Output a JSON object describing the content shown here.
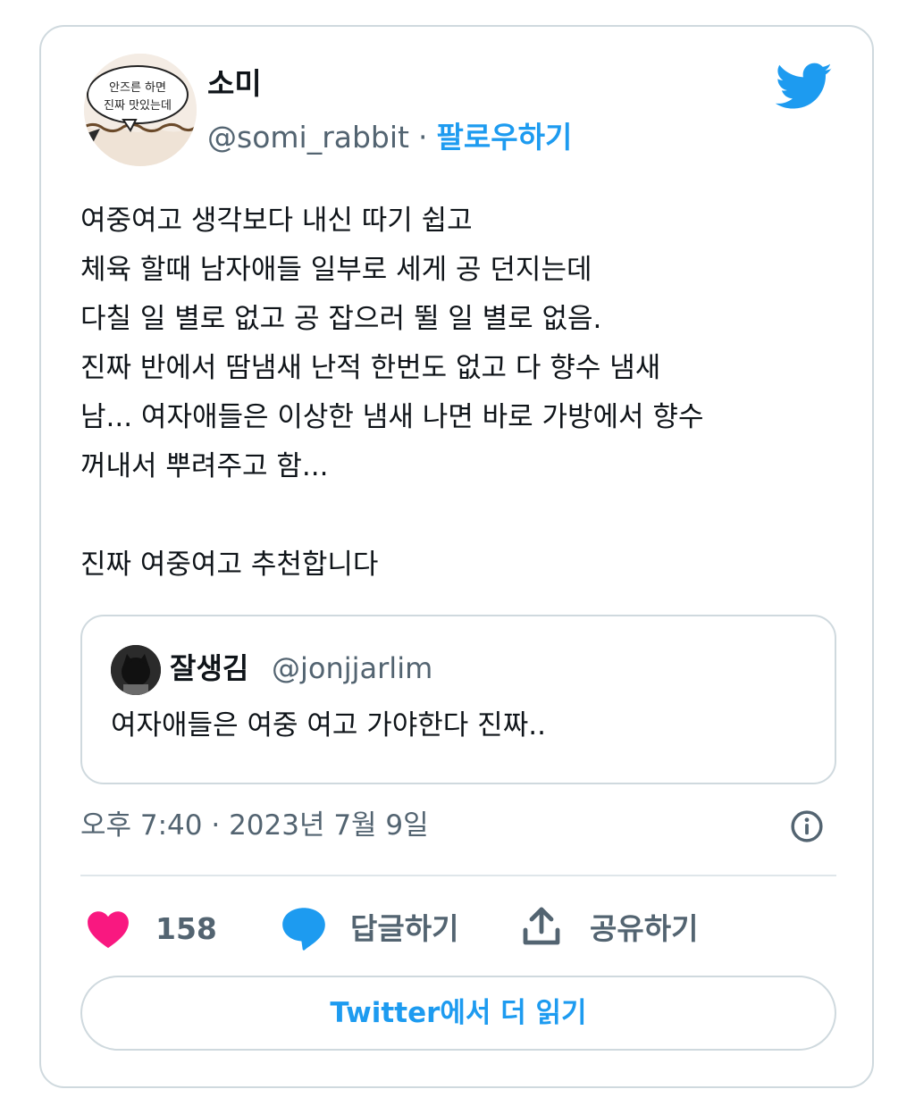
{
  "author": {
    "display_name": "소미",
    "handle": "@somi_rabbit",
    "separator": "·",
    "follow_label": "팔로우하기",
    "avatar_caption_line1": "안즈른 하면",
    "avatar_caption_line2": "진짜 맛있는데"
  },
  "tweet": {
    "lines": [
      "여중여고 생각보다 내신 따기 쉽고",
      "체육 할때 남자애들 일부로 세게 공 던지는데",
      "다칠 일 별로 없고 공 잡으러 뛸 일 별로 없음.",
      "진짜 반에서 땀냄새 난적 한번도 없고 다 향수 냄새",
      "남... 여자애들은 이상한 냄새 나면 바로 가방에서 향수",
      "꺼내서 뿌려주고 함...",
      "",
      "진짜 여중여고 추천합니다"
    ]
  },
  "quoted": {
    "display_name": "잘생김",
    "handle": "@jonjjarlim",
    "text": "여자애들은 여중 여고 가야한다 진짜.."
  },
  "timestamp": "오후 7:40 · 2023년 7월 9일",
  "actions": {
    "like_count": "158",
    "reply_label": "답글하기",
    "share_label": "공유하기"
  },
  "read_more_label": "Twitter에서 더 읽기",
  "colors": {
    "accent": "#1d9bf0",
    "heart": "#f91880",
    "secondary_text": "#536471",
    "border": "#cfd9de"
  },
  "icons": [
    "twitter-bird-icon",
    "info-icon",
    "heart-icon",
    "reply-bubble-icon",
    "share-icon"
  ]
}
